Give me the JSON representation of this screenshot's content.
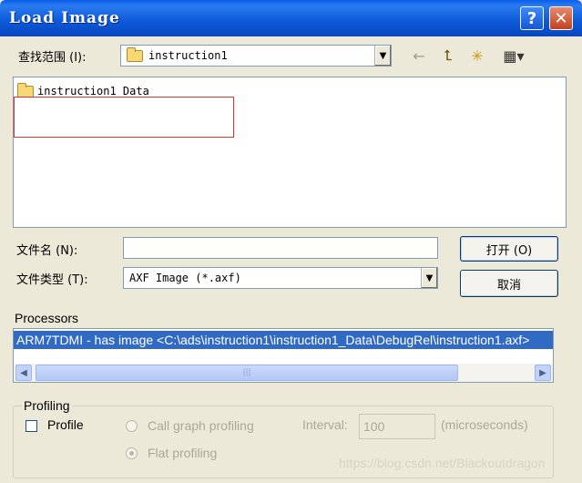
{
  "window": {
    "title": "Load Image",
    "help_label": "?",
    "close_label": "✕"
  },
  "look_in": {
    "label": "查找范围 (I):",
    "value": "instruction1",
    "arrow": "▼"
  },
  "toolbar": {
    "back_icon": "←",
    "up_icon": "⮤",
    "new_folder_icon": "✳",
    "view_menu_icon": "▦▾"
  },
  "file_list": {
    "items": [
      {
        "name": "instruction1_Data",
        "icon": "folder-icon"
      }
    ],
    "highlight_color": "#e03030"
  },
  "file_name": {
    "label": "文件名 (N):",
    "value": ""
  },
  "file_type": {
    "label": "文件类型 (T):",
    "value": "AXF Image (*.axf)",
    "arrow": "▼"
  },
  "buttons": {
    "open_label": "打开 (O)",
    "cancel_label": "取消"
  },
  "processors": {
    "label": "Processors",
    "rows": [
      "ARM7TDMI - has image <C:\\ads\\instruction1\\instruction1_Data\\DebugRel\\instruction1.axf>"
    ],
    "scroll_left": "◀",
    "scroll_right": "▶",
    "thumb_grip": "|||"
  },
  "profiling": {
    "group_label": "Profiling",
    "profile_label": "Profile",
    "call_graph_label": "Call graph profiling",
    "flat_label": "Flat profiling",
    "interval_label": "Interval:",
    "interval_value": "100",
    "interval_unit": "(microseconds)"
  },
  "watermark": "https://blog.csdn.net/Blackoutdragon",
  "colors": {
    "title_bar": "#0a5ee8",
    "selection": "#316ac5",
    "dialog_bg": "#ece9d8"
  }
}
